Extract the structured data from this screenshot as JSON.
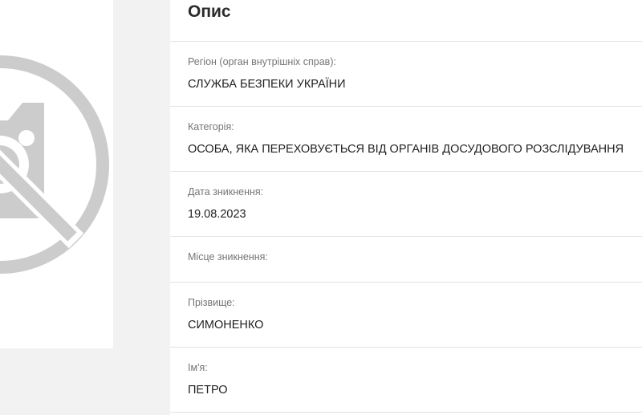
{
  "panel": {
    "title": "Опис"
  },
  "fields": {
    "region": {
      "label": "Регіон (орган внутрішніх справ):",
      "value": "СЛУЖБА БЕЗПЕКИ УКРАЇНИ"
    },
    "category": {
      "label": "Категорія:",
      "value": "ОСОБА, ЯКА ПЕРЕХОВУЄТЬСЯ ВІД ОРГАНІВ ДОСУДОВОГО РОЗСЛІДУВАННЯ"
    },
    "date": {
      "label": "Дата зникнення:",
      "value": "19.08.2023"
    },
    "place": {
      "label": "Місце зникнення:",
      "value": ""
    },
    "surname": {
      "label": "Прізвище:",
      "value": "СИМОНЕНКО"
    },
    "name": {
      "label": "Ім'я:",
      "value": "ПЕТРО"
    }
  },
  "photo": {
    "icon": "no-photo-icon",
    "color": "#cccccc"
  }
}
